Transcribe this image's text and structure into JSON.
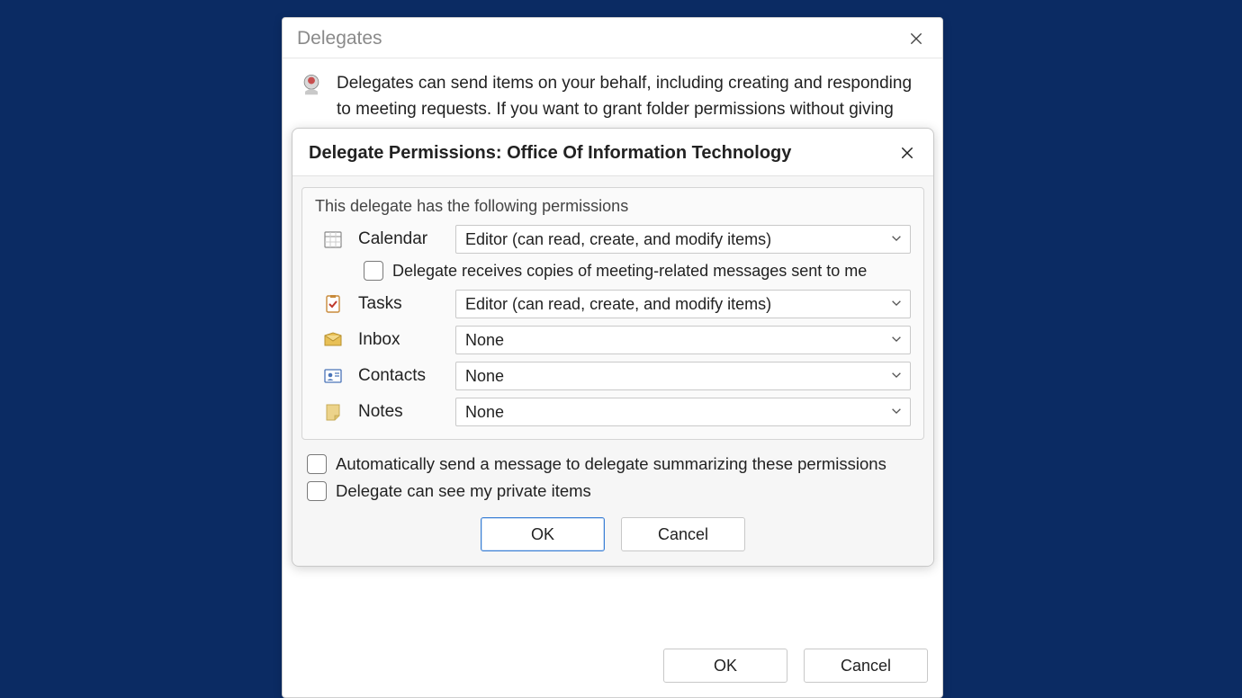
{
  "outer": {
    "title": "Delegates",
    "description": "Delegates can send items on your behalf, including creating and responding to meeting requests. If you want to grant folder permissions without giving",
    "ok_label": "OK",
    "cancel_label": "Cancel"
  },
  "inner": {
    "title": "Delegate Permissions: Office Of Information Technology",
    "intro": "This delegate has the following permissions",
    "rows": {
      "calendar": {
        "label": "Calendar",
        "value": "Editor (can read, create, and modify items)"
      },
      "tasks": {
        "label": "Tasks",
        "value": "Editor (can read, create, and modify items)"
      },
      "inbox": {
        "label": "Inbox",
        "value": "None"
      },
      "contacts": {
        "label": "Contacts",
        "value": "None"
      },
      "notes": {
        "label": "Notes",
        "value": "None"
      }
    },
    "calendar_sub_checkbox": "Delegate receives copies of meeting-related messages sent to me",
    "auto_send_checkbox": "Automatically send a message to delegate summarizing these permissions",
    "private_items_checkbox": "Delegate can see my private items",
    "ok_label": "OK",
    "cancel_label": "Cancel"
  }
}
